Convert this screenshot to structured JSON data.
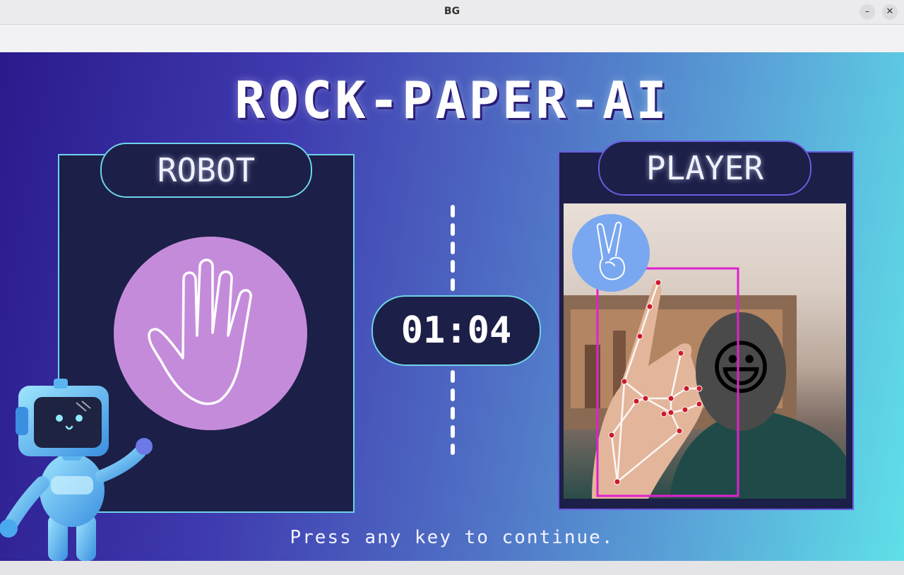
{
  "window": {
    "title": "BG",
    "minimize_label": "–",
    "close_label": "✕"
  },
  "game": {
    "title": "ROCK-PAPER-AI",
    "robot_label": "ROBOT",
    "player_label": "PLAYER",
    "timer": "01:04",
    "footer": "Press any key to continue.",
    "robot_move_icon": "open-hand-paper-icon",
    "player_move_icon": "peace-sign-scissors-icon",
    "face_emoji": "😃"
  },
  "colors": {
    "panel_bg": "#1c1f47",
    "robot_accent": "#6fd2ea",
    "player_accent": "#6a5ce0",
    "hand_circle": "#c58bdb",
    "detect_box": "#e020d0",
    "landmark": "#cc1a2a"
  }
}
